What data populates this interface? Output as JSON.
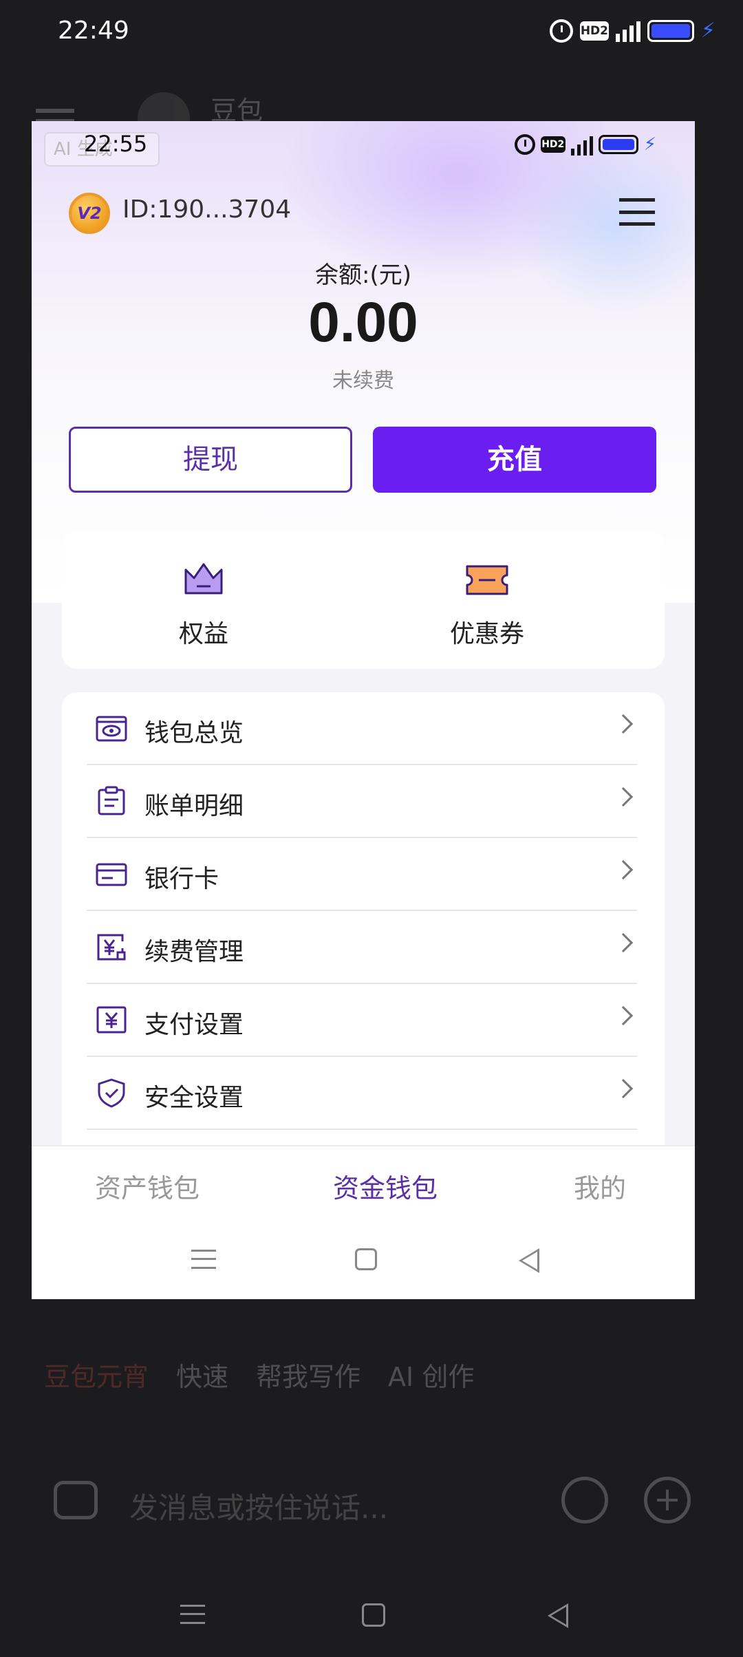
{
  "status_bar": {
    "time": "22:49",
    "hd_label": "HD2"
  },
  "background_app": {
    "name": "豆包",
    "chips": [
      "豆包元宵",
      "快速",
      "帮我写作",
      "AI 创作"
    ],
    "input_placeholder": "发消息或按住说话..."
  },
  "wallet_app": {
    "status_time": "22:55",
    "ai_badge": "AI 生成",
    "hd_label": "HD2",
    "user_id": "ID:190...3704",
    "logo_text": "V2",
    "balance_label": "余额:(元)",
    "balance_value": "0.00",
    "balance_status": "未续费",
    "withdraw_label": "提现",
    "recharge_label": "充值",
    "quick_actions": [
      {
        "label": "权益",
        "icon": "crown-icon"
      },
      {
        "label": "优惠券",
        "icon": "coupon-icon"
      }
    ],
    "menu_items": [
      {
        "label": "钱包总览",
        "icon": "wallet-eye-icon"
      },
      {
        "label": "账单明细",
        "icon": "bill-icon"
      },
      {
        "label": "银行卡",
        "icon": "bank-card-icon"
      },
      {
        "label": "续费管理",
        "icon": "renewal-icon"
      },
      {
        "label": "支付设置",
        "icon": "payment-icon"
      },
      {
        "label": "安全设置",
        "icon": "shield-icon"
      }
    ],
    "tabs": [
      "资产钱包",
      "资金钱包",
      "我的"
    ],
    "active_tab": "资金钱包",
    "accent_color": "#6b1ef0",
    "brand_purple": "#5b2fa8"
  }
}
